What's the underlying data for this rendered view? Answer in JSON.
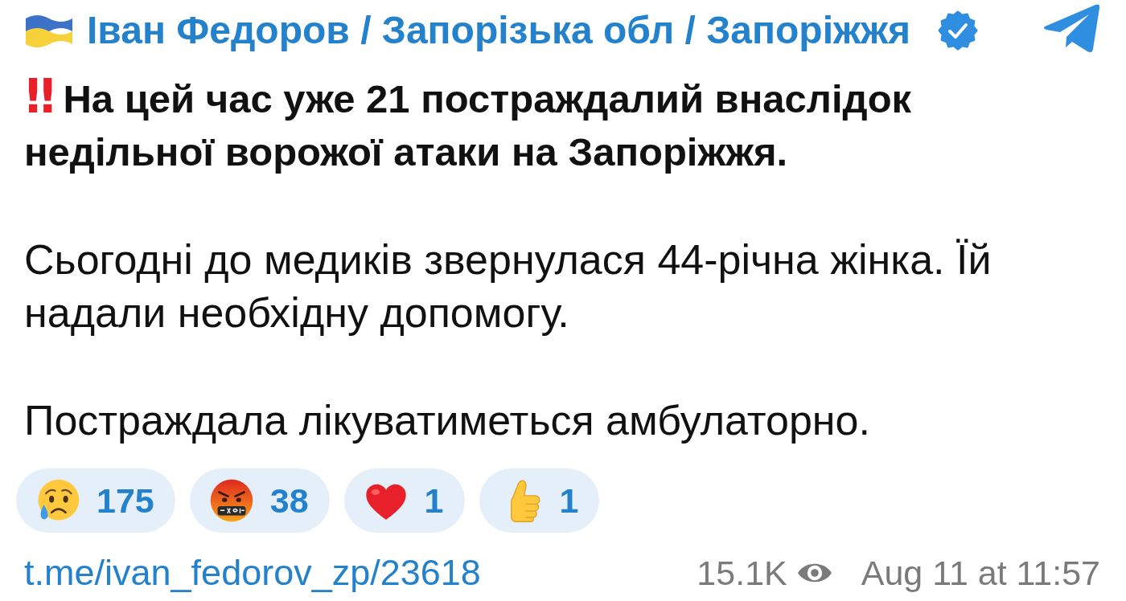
{
  "header": {
    "channel_name": "Іван Федоров / Запорізька обл / Запоріжжя",
    "verified": true
  },
  "message": {
    "paragraphs": [
      {
        "emoji": "‼",
        "text": "На цей час уже 21 постраждалий внаслідок недільної ворожої атаки на Запоріжжя.",
        "bold": true
      },
      {
        "text": "Сьогодні до медиків звернулася 44-річна жінка. Їй надали необхідну допомогу.",
        "bold": false
      },
      {
        "text": "Постраждала лікуватиметься амбулаторно.",
        "bold": false
      }
    ]
  },
  "reactions": [
    {
      "kind": "crying",
      "count": "175",
      "selected": false
    },
    {
      "kind": "cursing",
      "count": "38",
      "selected": false
    },
    {
      "kind": "heart",
      "count": "1",
      "selected": false
    },
    {
      "kind": "thumbs_up",
      "count": "1",
      "selected": false
    }
  ],
  "footer": {
    "link": "t.me/ivan_fedorov_zp/23618",
    "views": "15.1K",
    "date": "Aug 11 at 11:57"
  }
}
